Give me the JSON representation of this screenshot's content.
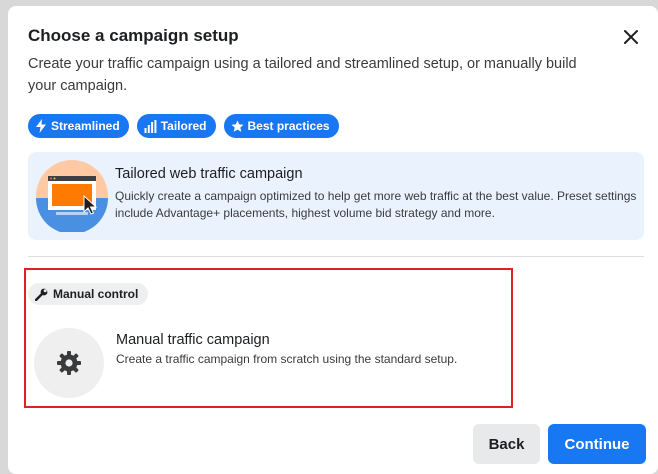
{
  "dialog": {
    "title": "Choose a campaign setup",
    "subtitle": "Create your traffic campaign using a tailored and streamlined setup, or manually build your campaign.",
    "close_icon": "close-icon"
  },
  "badges": [
    {
      "label": "Streamlined",
      "icon": "lightning-icon"
    },
    {
      "label": "Tailored",
      "icon": "bar-chart-icon"
    },
    {
      "label": "Best practices",
      "icon": "star-icon"
    }
  ],
  "tailored_option": {
    "title": "Tailored web traffic campaign",
    "description": "Quickly create a campaign optimized to help get more web traffic at the best value. Preset settings include Advantage+ placements, highest volume bid strategy and more."
  },
  "manual_option": {
    "badge_label": "Manual control",
    "badge_icon": "wrench-icon",
    "title": "Manual traffic campaign",
    "description": "Create a traffic campaign from scratch using the standard setup.",
    "icon": "gear-icon"
  },
  "footer": {
    "back_label": "Back",
    "continue_label": "Continue"
  },
  "colors": {
    "accent": "#1877f2",
    "highlight_border": "#e02121",
    "tailored_card_bg": "#eaf2fd"
  }
}
